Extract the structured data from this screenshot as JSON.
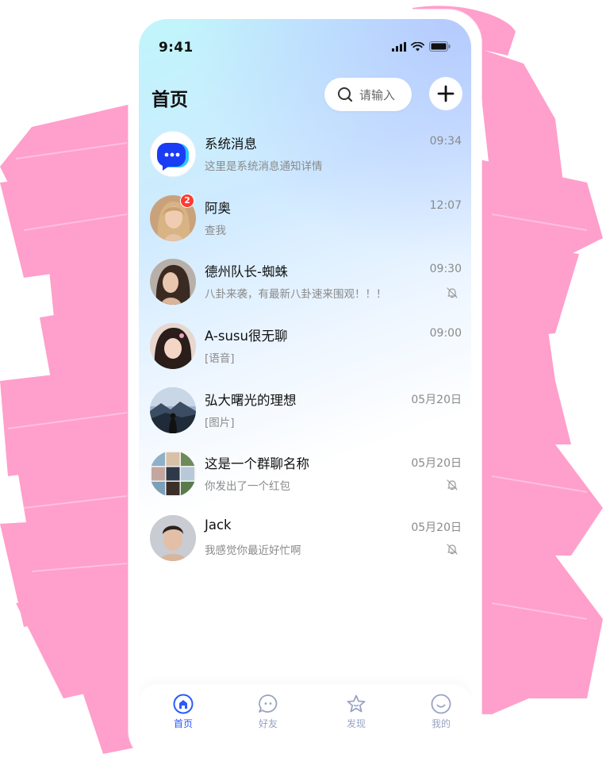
{
  "status_bar": {
    "time": "9:41"
  },
  "header": {
    "title": "首页",
    "search_placeholder": "请输入"
  },
  "chats": [
    {
      "name": "系统消息",
      "preview": "这里是系统消息通知详情",
      "time": "09:34",
      "badge": "",
      "muted": false,
      "avatar": "system-chat-icon"
    },
    {
      "name": "阿奥",
      "preview": "查我",
      "time": "12:07",
      "badge": "2",
      "muted": false,
      "avatar": "woman-blonde-avatar"
    },
    {
      "name": "德州队长-蜘蛛",
      "preview": "八卦来袭，有最新八卦速来围观！！！",
      "time": "09:30",
      "badge": "",
      "muted": true,
      "avatar": "woman-dark-hair-avatar"
    },
    {
      "name": "A-susu很无聊",
      "preview": "[语音]",
      "time": "09:00",
      "badge": "",
      "muted": false,
      "avatar": "girl-bangs-avatar"
    },
    {
      "name": "弘大曙光的理想",
      "preview": "[图片]",
      "time": "05月20日",
      "badge": "",
      "muted": false,
      "avatar": "mountain-landscape-avatar"
    },
    {
      "name": " 这是一个群聊名称",
      "preview": "你发出了一个红包",
      "time": "05月20日",
      "badge": "",
      "muted": true,
      "avatar": "group-grid-avatar"
    },
    {
      "name": "Jack",
      "preview": "我感觉你最近好忙啊",
      "time": "05月20日",
      "badge": "",
      "muted": true,
      "avatar": "man-portrait-avatar"
    }
  ],
  "tabs": [
    {
      "label": "首页",
      "icon": "home-icon",
      "active": true
    },
    {
      "label": "好友",
      "icon": "chat-bubble-icon",
      "active": false
    },
    {
      "label": "发现",
      "icon": "star-icon",
      "active": false
    },
    {
      "label": "我的",
      "icon": "smile-icon",
      "active": false
    }
  ],
  "colors": {
    "background_brush": "#ff9fcb",
    "accent": "#2a5bff",
    "badge": "#ff3b30",
    "tab_inactive": "#9aa3c4"
  }
}
